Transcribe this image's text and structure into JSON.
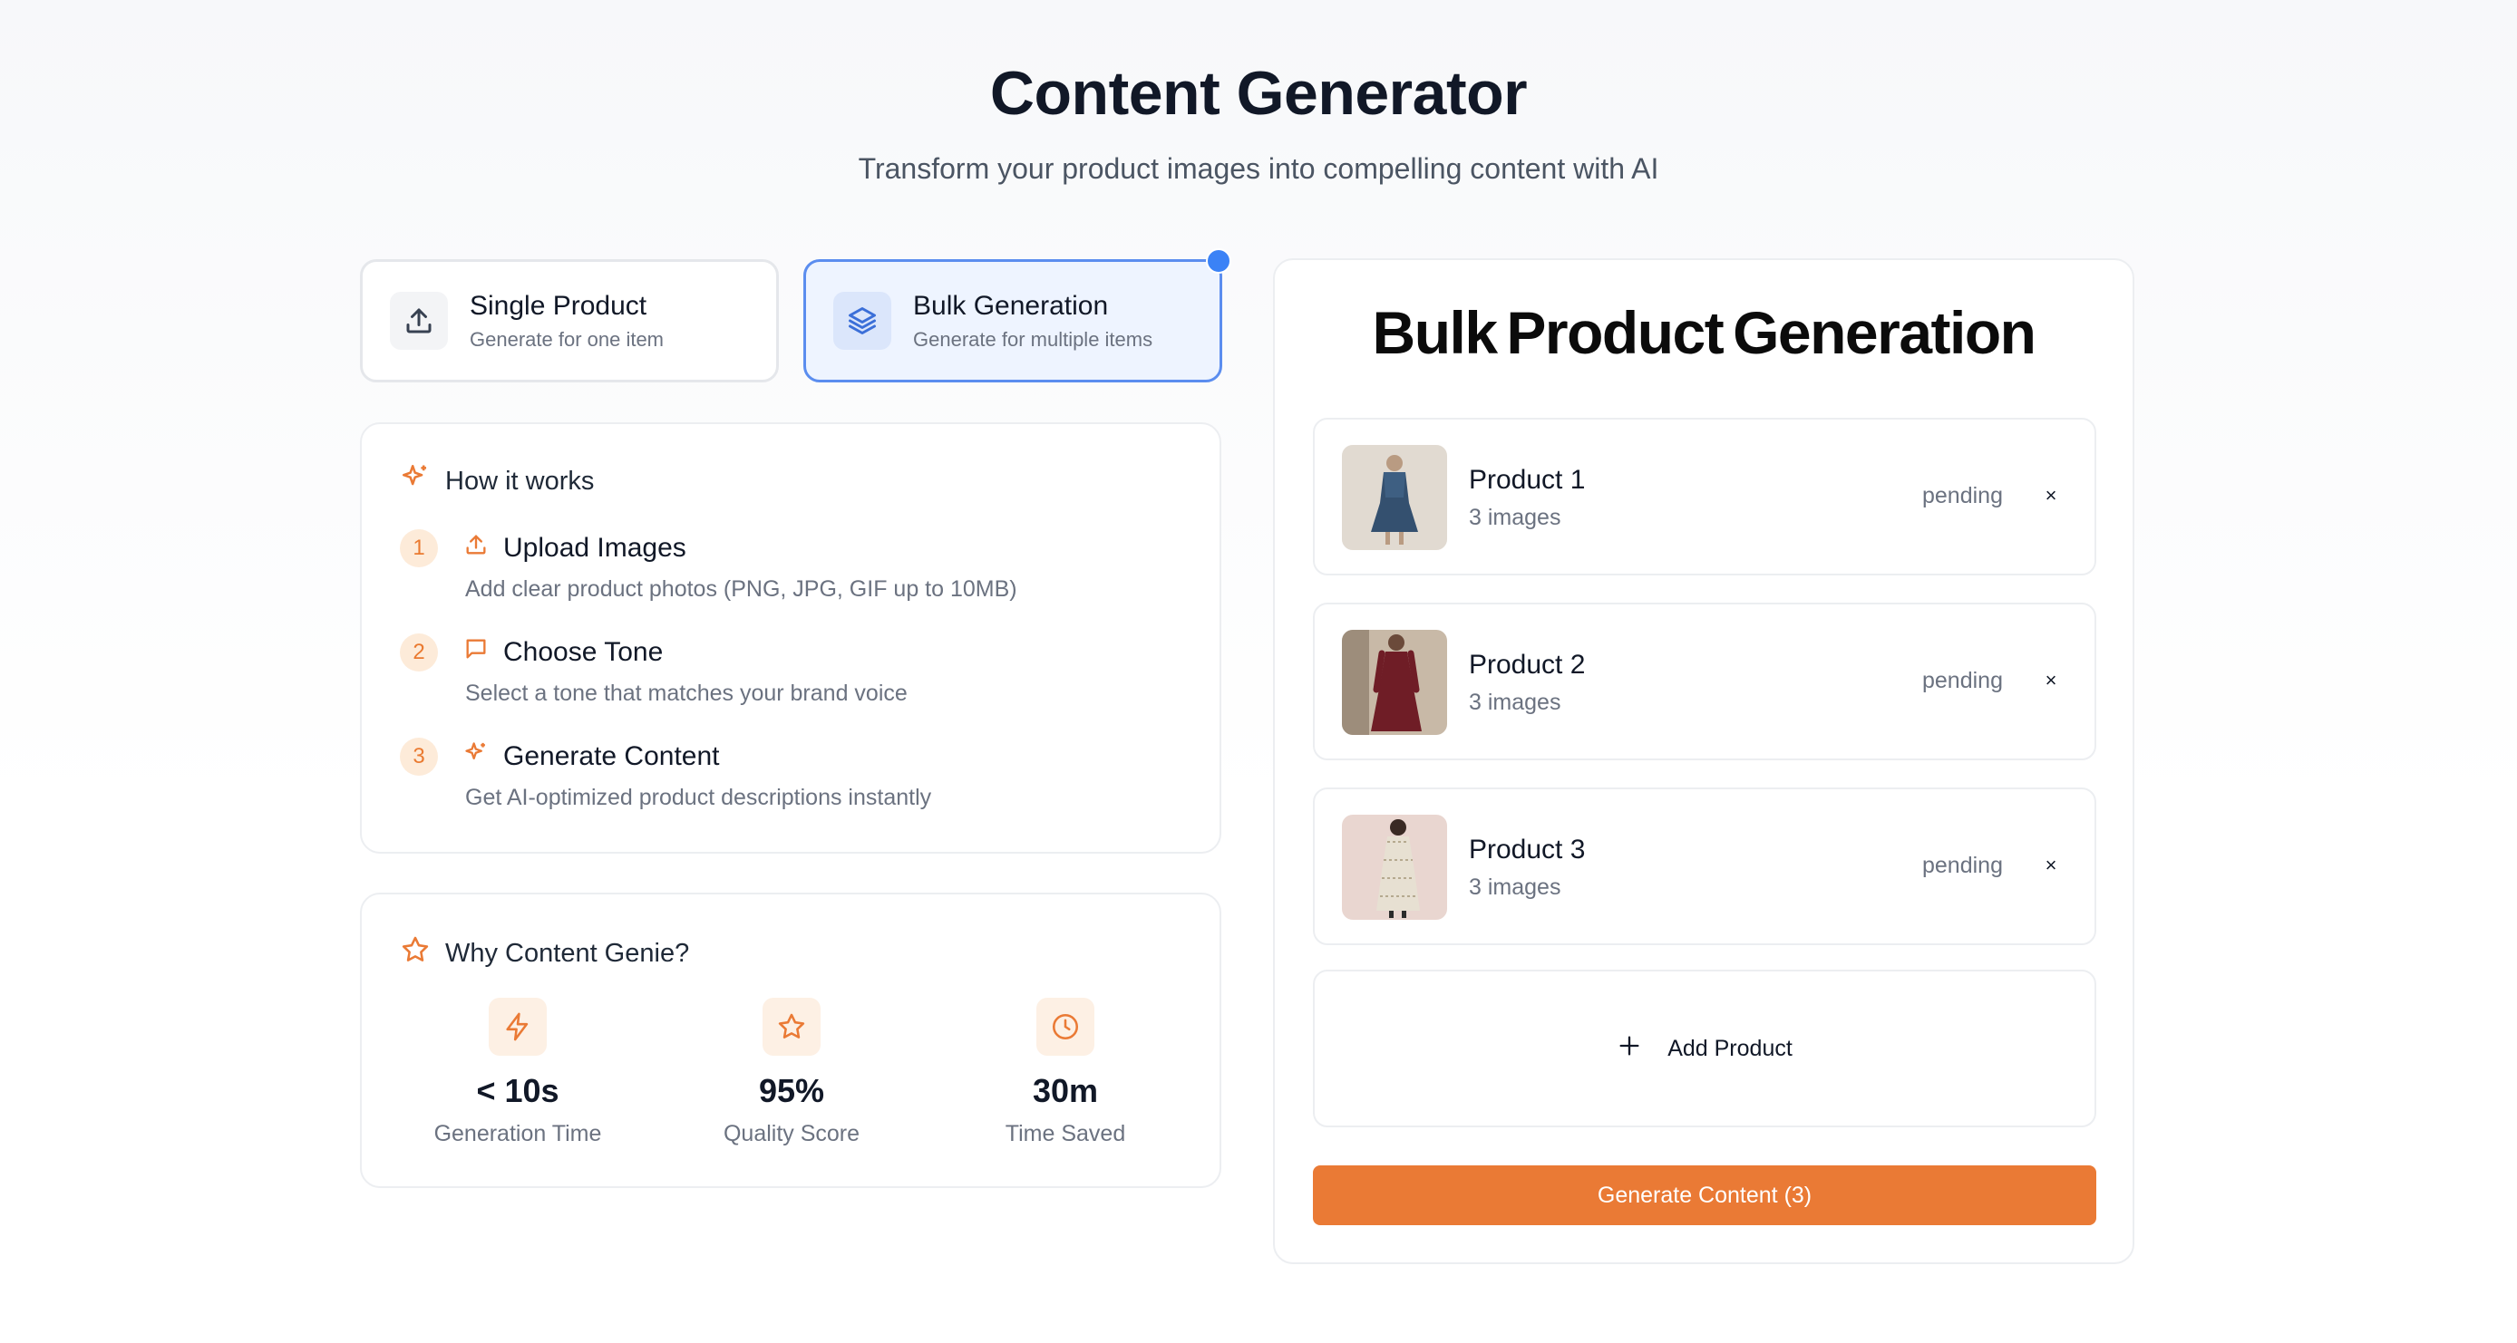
{
  "header": {
    "title": "Content Generator",
    "subtitle": "Transform your product images into compelling content with AI"
  },
  "modes": {
    "single": {
      "title": "Single Product",
      "desc": "Generate for one item",
      "icon": "upload-icon"
    },
    "bulk": {
      "title": "Bulk Generation",
      "desc": "Generate for multiple items",
      "icon": "layers-icon"
    },
    "active": "bulk"
  },
  "how_it_works": {
    "heading": "How it works",
    "steps": [
      {
        "num": "1",
        "title": "Upload Images",
        "desc": "Add clear product photos (PNG, JPG, GIF up to 10MB)",
        "icon": "upload-icon"
      },
      {
        "num": "2",
        "title": "Choose Tone",
        "desc": "Select a tone that matches your brand voice",
        "icon": "message-icon"
      },
      {
        "num": "3",
        "title": "Generate Content",
        "desc": "Get AI-optimized product descriptions instantly",
        "icon": "sparkles-icon"
      }
    ]
  },
  "why": {
    "heading": "Why Content Genie?",
    "stats": [
      {
        "value": "< 10s",
        "label": "Generation Time",
        "icon": "zap-icon"
      },
      {
        "value": "95%",
        "label": "Quality Score",
        "icon": "star-icon"
      },
      {
        "value": "30m",
        "label": "Time Saved",
        "icon": "clock-icon"
      }
    ]
  },
  "bulk": {
    "title": "Bulk Product Generation",
    "products": [
      {
        "name": "Product 1",
        "count": "3 images",
        "status": "pending",
        "remove": "×"
      },
      {
        "name": "Product 2",
        "count": "3 images",
        "status": "pending",
        "remove": "×"
      },
      {
        "name": "Product 3",
        "count": "3 images",
        "status": "pending",
        "remove": "×"
      }
    ],
    "add_label": "Add Product",
    "generate_label": "Generate Content (3)"
  },
  "colors": {
    "accent": "#ea7a35",
    "active_blue": "#5b8def",
    "active_bg": "#eef4ff"
  }
}
